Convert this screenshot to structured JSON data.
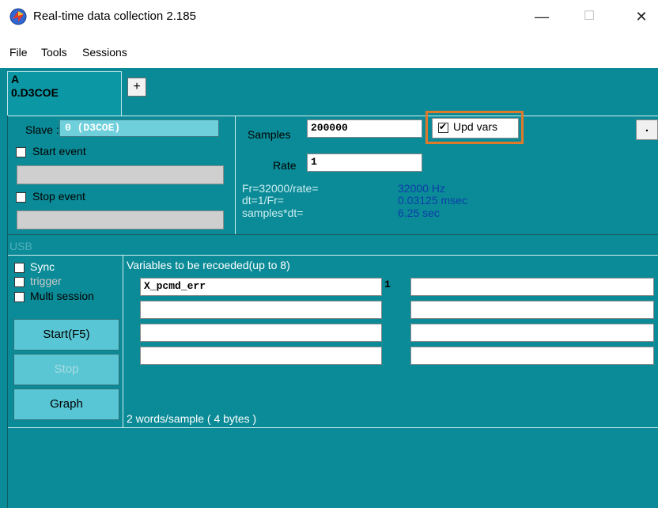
{
  "window": {
    "title": "Real-time data collection 2.185",
    "minimize": "—",
    "maximize": "☐",
    "close": "✕"
  },
  "menu": [
    "File",
    "Tools",
    "Sessions"
  ],
  "tab": {
    "line1": "A",
    "line2": "0.D3COE",
    "add": "+"
  },
  "slave": {
    "label": "Slave :",
    "value": "0 (D3COE)"
  },
  "events": {
    "start": "Start event",
    "stop": "Stop event"
  },
  "samples": {
    "label": "Samples",
    "value": "200000",
    "upd_label": "Upd vars",
    "upd_checked": true
  },
  "rate": {
    "label": "Rate",
    "value": "1"
  },
  "info": {
    "fr_label": "Fr=32000/rate=",
    "fr_value": "32000 Hz",
    "dt_label": "dt=1/Fr=",
    "dt_value": "0.03125 msec",
    "sdt_label": "samples*dt=",
    "sdt_value": "6.25 sec"
  },
  "side_dot": ".",
  "usb_label": "USB",
  "options": {
    "sync": "Sync",
    "trigger": "trigger",
    "multi": "Multi session"
  },
  "buttons": {
    "start": "Start(F5)",
    "stop": "Stop",
    "graph": "Graph"
  },
  "variables": {
    "header": "Variables to be recoeded(up to 8)",
    "left": [
      "X_pcmd_err",
      "",
      "",
      ""
    ],
    "right": [
      "",
      "",
      "",
      ""
    ],
    "marker": "1",
    "footer": "2 words/sample ( 4 bytes )"
  }
}
